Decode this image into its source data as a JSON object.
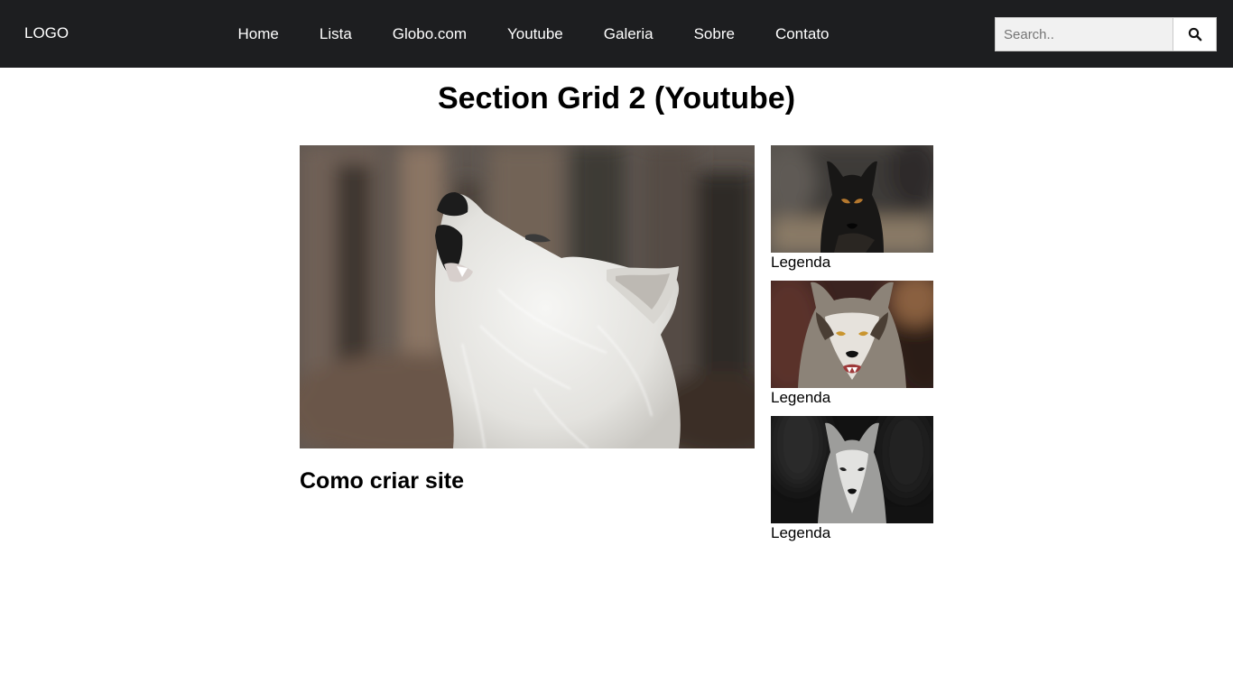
{
  "header": {
    "logo": "LOGO",
    "menu": [
      {
        "label": "Home"
      },
      {
        "label": "Lista"
      },
      {
        "label": "Globo.com"
      },
      {
        "label": "Youtube"
      },
      {
        "label": "Galeria"
      },
      {
        "label": "Sobre"
      },
      {
        "label": "Contato"
      }
    ],
    "search": {
      "placeholder": "Search..",
      "value": "",
      "button_icon": "search-icon"
    }
  },
  "section": {
    "title": "Section Grid 2 (Youtube)"
  },
  "main_video": {
    "image": "white wolf howling",
    "caption": "Como criar site"
  },
  "side_videos": [
    {
      "image": "black wolf",
      "caption": "Legenda"
    },
    {
      "image": "grey wolf",
      "caption": "Legenda"
    },
    {
      "image": "white wolf on dark background",
      "caption": "Legenda"
    }
  ],
  "colors": {
    "navbar_bg": "#1d1e20",
    "navbar_text": "#ffffff",
    "search_bg": "#f1f1f1",
    "page_bg": "#ffffff"
  }
}
